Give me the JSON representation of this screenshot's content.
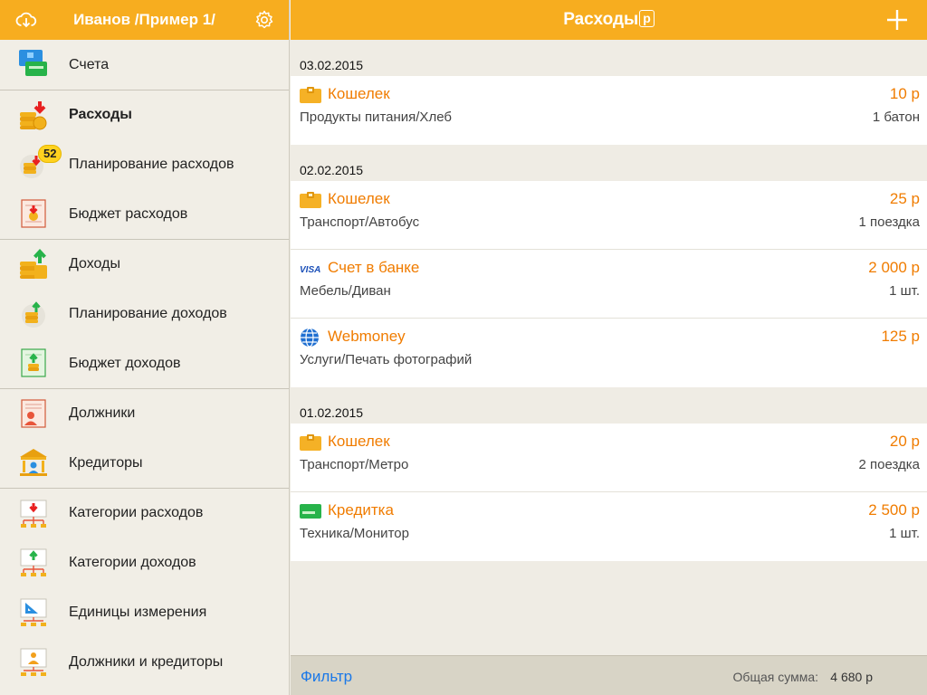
{
  "sidebar": {
    "title": "Иванов /Пример 1/",
    "items": [
      {
        "label": "Счета"
      },
      {
        "label": "Расходы"
      },
      {
        "label": "Планирование расходов",
        "badge": "52"
      },
      {
        "label": "Бюджет расходов"
      },
      {
        "label": "Доходы"
      },
      {
        "label": "Планирование доходов"
      },
      {
        "label": "Бюджет доходов"
      },
      {
        "label": "Должники"
      },
      {
        "label": "Кредиторы"
      },
      {
        "label": "Категории расходов"
      },
      {
        "label": "Категории доходов"
      },
      {
        "label": "Единицы измерения"
      },
      {
        "label": "Должники и кредиторы"
      }
    ]
  },
  "main": {
    "title": "Расходы",
    "currency_symbol": "р",
    "groups": [
      {
        "date": "03.02.2015",
        "records": [
          {
            "account": "Кошелек",
            "account_icon": "wallet-icon",
            "amount": "10 р",
            "category": "Продукты питания/Хлеб",
            "qty": "1 батон"
          }
        ]
      },
      {
        "date": "02.02.2015",
        "records": [
          {
            "account": "Кошелек",
            "account_icon": "wallet-icon",
            "amount": "25 р",
            "category": "Транспорт/Автобус",
            "qty": "1 поездка"
          },
          {
            "account": "Счет в банке",
            "account_icon": "visa-icon",
            "amount": "2 000 р",
            "category": "Мебель/Диван",
            "qty": "1 шт."
          },
          {
            "account": "Webmoney",
            "account_icon": "webmoney-icon",
            "amount": "125 р",
            "category": "Услуги/Печать фотографий",
            "qty": ""
          }
        ]
      },
      {
        "date": "01.02.2015",
        "records": [
          {
            "account": "Кошелек",
            "account_icon": "wallet-icon",
            "amount": "20 р",
            "category": "Транспорт/Метро",
            "qty": "2 поездка"
          },
          {
            "account": "Кредитка",
            "account_icon": "credit-card-icon",
            "amount": "2 500 р",
            "category": "Техника/Монитор",
            "qty": "1 шт."
          }
        ]
      }
    ],
    "footer": {
      "filter_label": "Фильтр",
      "total_label": "Общая сумма:",
      "total_value": "4 680 р"
    }
  },
  "colors": {
    "header_bg": "#f7ad1f",
    "accent_orange": "#f07c00",
    "link_blue": "#1a78e8"
  }
}
